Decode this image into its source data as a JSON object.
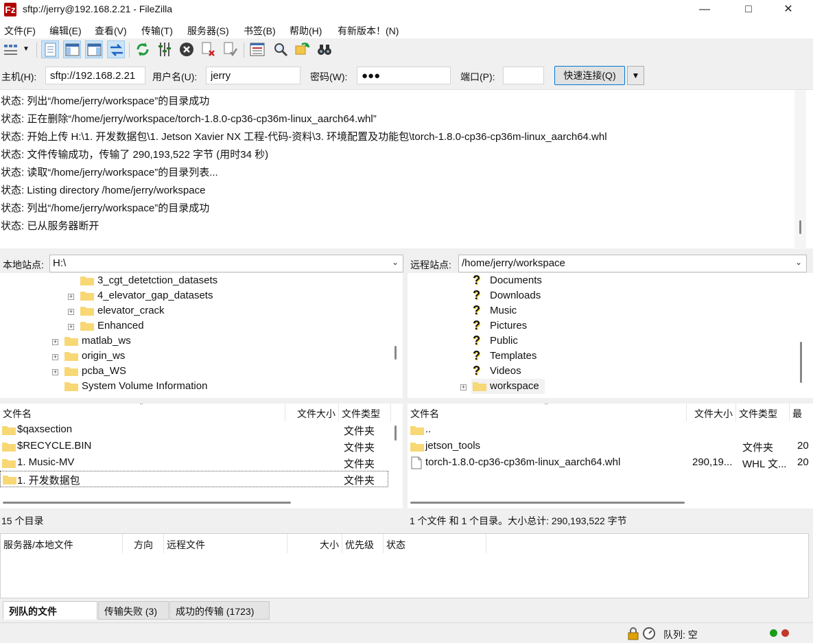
{
  "window": {
    "title": "sftp://jerry@192.168.2.21 - FileZilla",
    "app_icon": "Fz",
    "controls": [
      "minimize-icon",
      "maximize-icon",
      "close-icon"
    ]
  },
  "menu": [
    "文件(F)",
    "编辑(E)",
    "查看(V)",
    "传输(T)",
    "服务器(S)",
    "书签(B)",
    "帮助(H)",
    "有新版本！(N)"
  ],
  "quickconnect": {
    "host_label": "主机(H):",
    "host_value": "sftp://192.168.2.21",
    "user_label": "用户名(U):",
    "user_value": "jerry",
    "pass_label": "密码(W):",
    "pass_value": "●●●",
    "port_label": "端口(P):",
    "port_value": "",
    "connect_label": "快速连接(Q)",
    "dropdown_glyph": "▼"
  },
  "log": [
    "状态:  列出“/home/jerry/workspace”的目录成功",
    "状态:  正在删除“/home/jerry/workspace/torch-1.8.0-cp36-cp36m-linux_aarch64.whl”",
    "状态:  开始上传 H:\\1. 开发数据包\\1. Jetson Xavier NX 工程-代码-资料\\3. 环境配置及功能包\\torch-1.8.0-cp36-cp36m-linux_aarch64.whl",
    "状态:  文件传输成功，传输了 290,193,522 字节 (用时34 秒)",
    "状态:  读取“/home/jerry/workspace”的目录列表...",
    "状态:  Listing directory /home/jerry/workspace",
    "状态:  列出“/home/jerry/workspace”的目录成功",
    "状态:  已从服务器断开"
  ],
  "local": {
    "site_label": "本地站点:",
    "site_path": "H:\\",
    "tree": [
      "3_cgt_detetction_datasets",
      "4_elevator_gap_datasets",
      "elevator_crack",
      "Enhanced",
      "matlab_ws",
      "origin_ws",
      "pcba_WS",
      "System Volume Information"
    ],
    "columns": [
      "文件名",
      "文件大小",
      "文件类型"
    ],
    "files": [
      {
        "name": "$qaxsection",
        "size": "",
        "type": "文件夹"
      },
      {
        "name": "$RECYCLE.BIN",
        "size": "",
        "type": "文件夹"
      },
      {
        "name": "1. Music-MV",
        "size": "",
        "type": "文件夹"
      },
      {
        "name": "1. 开发数据包",
        "size": "",
        "type": "文件夹"
      }
    ],
    "status": "15 个目录"
  },
  "remote": {
    "site_label": "远程站点:",
    "site_path": "/home/jerry/workspace",
    "tree": [
      "Documents",
      "Downloads",
      "Music",
      "Pictures",
      "Public",
      "Templates",
      "Videos",
      "workspace"
    ],
    "columns": [
      "文件名",
      "文件大小",
      "文件类型",
      "最"
    ],
    "files": [
      {
        "name": "..",
        "size": "",
        "type": "",
        "date": ""
      },
      {
        "name": "jetson_tools",
        "size": "",
        "type": "文件夹",
        "date": "20"
      },
      {
        "name": "torch-1.8.0-cp36-cp36m-linux_aarch64.whl",
        "size": "290,19...",
        "type": "WHL 文...",
        "date": "20"
      }
    ],
    "status": "1 个文件 和 1 个目录。大小总计: 290,193,522 字节"
  },
  "queue": {
    "columns": [
      "服务器/本地文件",
      "方向",
      "远程文件",
      "大小",
      "优先级",
      "状态"
    ],
    "tabs": [
      "列队的文件",
      "传输失败 (3)",
      "成功的传输 (1723)"
    ]
  },
  "statusbar": {
    "queue_text": "队列: 空"
  },
  "colors": {
    "folder": "#f8d775",
    "accent": "#0078d7",
    "led_green": "#1a9c1a",
    "led_red": "#c0392b"
  }
}
